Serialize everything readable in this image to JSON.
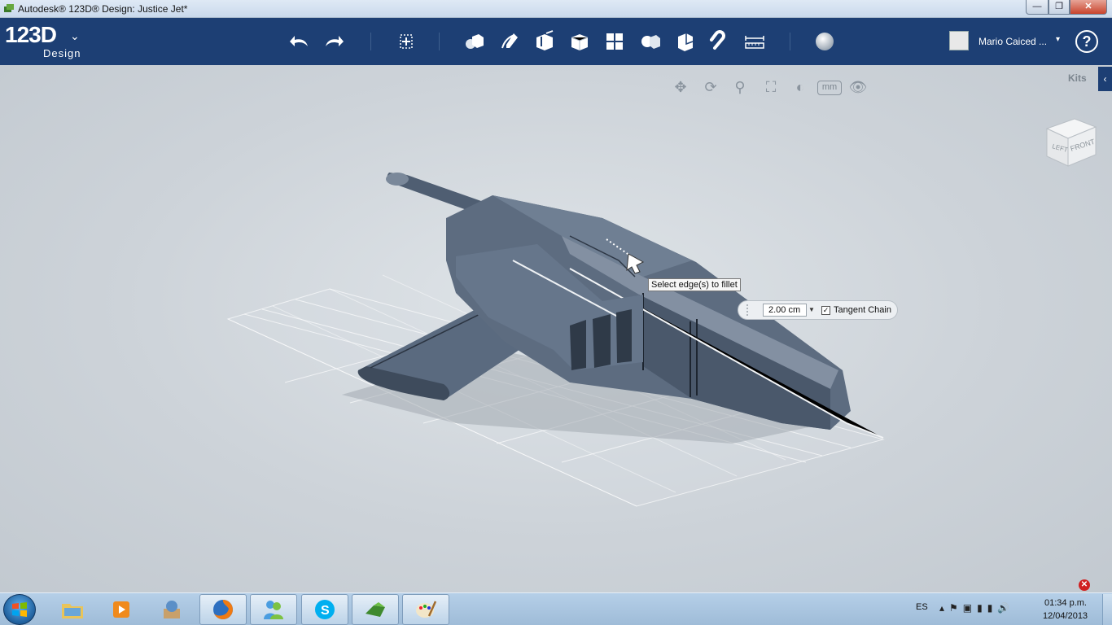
{
  "window": {
    "title": "Autodesk® 123D® Design: Justice Jet*",
    "controls": {
      "minimize": "—",
      "maximize": "❐",
      "close": "✕"
    }
  },
  "brand": {
    "name": "123D",
    "sub": "Design",
    "chevron": "⌄",
    "accent": "#1d3f74"
  },
  "toolbar": {
    "tools": [
      {
        "id": "undo",
        "icon": "undo-icon"
      },
      {
        "id": "redo",
        "icon": "redo-icon"
      },
      {
        "id": "transform",
        "icon": "transform-icon"
      },
      {
        "id": "primitives",
        "icon": "primitives-icon"
      },
      {
        "id": "sketch",
        "icon": "sketch-icon"
      },
      {
        "id": "construct",
        "icon": "construct-icon"
      },
      {
        "id": "modify",
        "icon": "modify-icon"
      },
      {
        "id": "pattern",
        "icon": "pattern-icon"
      },
      {
        "id": "group",
        "icon": "group-icon"
      },
      {
        "id": "combine",
        "icon": "combine-icon"
      },
      {
        "id": "snap",
        "icon": "snap-icon"
      },
      {
        "id": "measure",
        "icon": "measure-icon"
      },
      {
        "id": "material",
        "icon": "material-sphere-icon"
      }
    ]
  },
  "user": {
    "name": "Mario Caiced ...",
    "caret": "▾",
    "help": "?"
  },
  "viewport": {
    "nav_tools": [
      "pan-icon",
      "orbit-icon",
      "zoom-icon",
      "fit-icon",
      "visual-style-icon"
    ],
    "units": "mm",
    "kits_label": "Kits",
    "kits_toggle": "‹",
    "viewcube": {
      "left": "LEFT",
      "front": "FRONT"
    },
    "tooltip": "Select edge(s) to fillet",
    "fillet": {
      "value": "2.00 cm",
      "tangent_chain_label": "Tangent Chain",
      "tangent_chain_checked": true
    }
  },
  "taskbar": {
    "items": [
      {
        "name": "windows-explorer",
        "icon": "folder-icon"
      },
      {
        "name": "media-player",
        "icon": "media-player-icon"
      },
      {
        "name": "app-archive",
        "icon": "archive-icon"
      },
      {
        "name": "firefox",
        "icon": "firefox-icon"
      },
      {
        "name": "messenger",
        "icon": "messenger-icon"
      },
      {
        "name": "skype",
        "icon": "skype-icon"
      },
      {
        "name": "123d-design",
        "icon": "123d-design-icon"
      },
      {
        "name": "paint",
        "icon": "paint-icon"
      }
    ],
    "language": "ES",
    "clock": {
      "time": "01:34 p.m.",
      "date": "12/04/2013"
    }
  }
}
